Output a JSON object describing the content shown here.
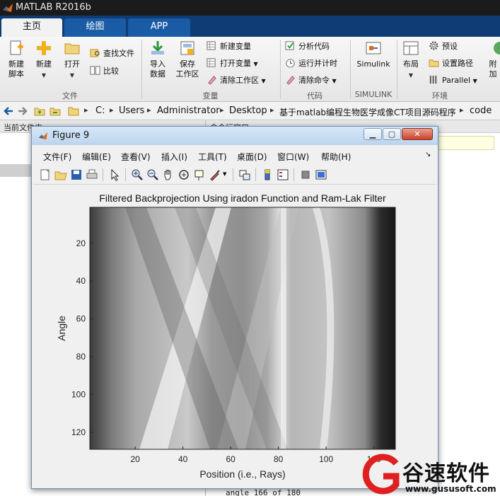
{
  "app": {
    "title": "MATLAB R2016b"
  },
  "tabs": [
    {
      "label": "主页",
      "active": true
    },
    {
      "label": "绘图",
      "active": false
    },
    {
      "label": "APP",
      "active": false
    }
  ],
  "ribbon": {
    "file": {
      "new_script": [
        "新建",
        "脚本"
      ],
      "new": "新建",
      "open": "打开",
      "find_files": "查找文件",
      "compare": "比较",
      "group_label": "文件"
    },
    "variable": {
      "import_data": [
        "导入",
        "数据"
      ],
      "save_workspace": [
        "保存",
        "工作区"
      ],
      "new_variable": "新建变量",
      "open_variable": "打开变量",
      "clear_workspace": "清除工作区",
      "group_label": "变量"
    },
    "code": {
      "analyze_code": "分析代码",
      "run_and_time": "运行并计时",
      "clear_commands": "清除命令",
      "group_label": "代码"
    },
    "simulink": {
      "simulink": "Simulink",
      "group_label": "SIMULINK"
    },
    "environment": {
      "layout": "布局",
      "preferences": "预设",
      "set_path": "设置路径",
      "parallel": "Parallel",
      "addons": "附加",
      "group_label": "环境"
    }
  },
  "address": {
    "crumbs": [
      "C:",
      "Users",
      "Administrator",
      "Desktop",
      "基于matlab编程生物医学成像CT项目源码程序",
      "code"
    ]
  },
  "panels": {
    "current_folder": "当前文件夹",
    "command_window": "命令行窗口",
    "command_tail": "angle 166 of 180"
  },
  "figure": {
    "title": "Figure 9",
    "menus": [
      "文件(F)",
      "编辑(E)",
      "查看(V)",
      "插入(I)",
      "工具(T)",
      "桌面(D)",
      "窗口(W)",
      "帮助(H)"
    ]
  },
  "chart_data": {
    "type": "heatmap",
    "title": "Filtered Backprojection Using iradon Function and Ram-Lak Filter",
    "xlabel": "Position (i.e., Rays)",
    "ylabel": "Angle",
    "xticks": [
      20,
      40,
      60,
      80,
      100,
      120
    ],
    "yticks": [
      20,
      40,
      60,
      80,
      100,
      120
    ],
    "xlim": [
      1,
      129
    ],
    "ylim": [
      1,
      129
    ],
    "colormap": "gray"
  },
  "watermark": {
    "brand": "谷速软件",
    "site": "www.gususoft.com"
  },
  "colors": {
    "title_bar": "#1b1b1b",
    "tab_bar": "#0f3c74",
    "ribbon_bg": "#f0f0f0",
    "watermark_red": "#e02020"
  }
}
